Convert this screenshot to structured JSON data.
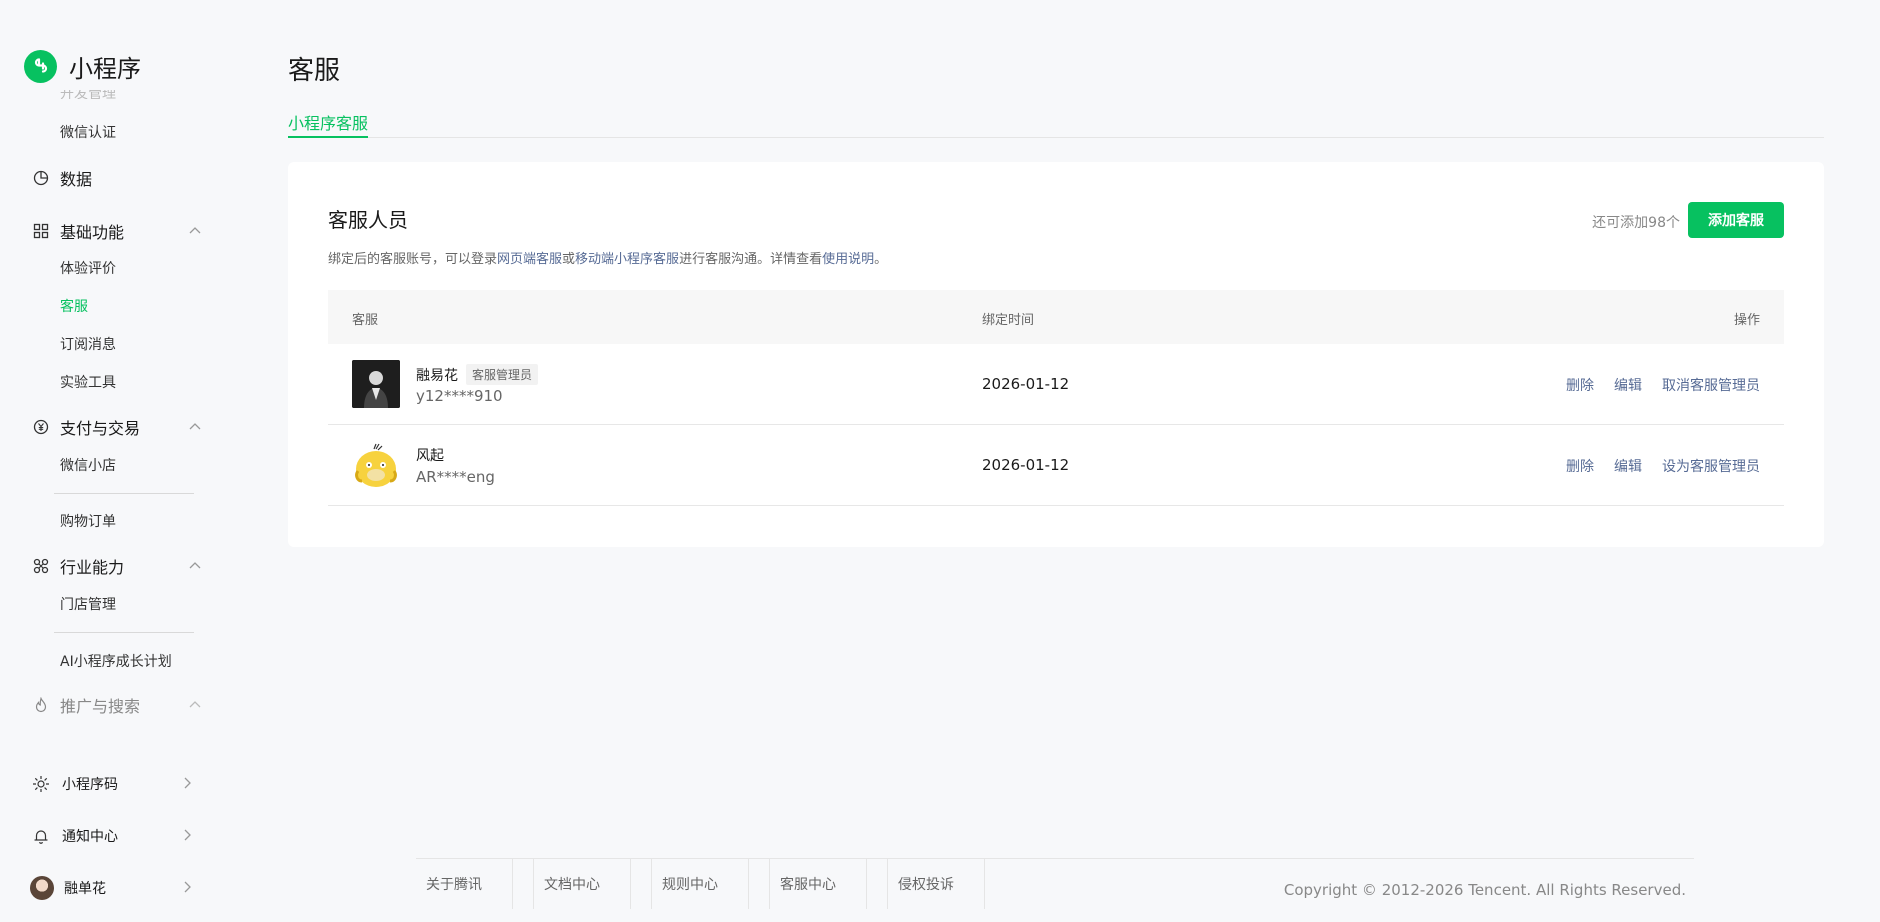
{
  "brand": {
    "name": "小程序"
  },
  "sidebar": {
    "partial_top": "开发管理",
    "items": [
      {
        "type": "sub",
        "label": "微信认证"
      },
      {
        "type": "group",
        "label": "数据",
        "icon": "clock-pie-icon"
      },
      {
        "type": "group",
        "label": "基础功能",
        "icon": "grid-apps-icon",
        "expanded": true
      },
      {
        "type": "sub",
        "label": "体验评价"
      },
      {
        "type": "sub",
        "label": "客服",
        "active": true
      },
      {
        "type": "sub",
        "label": "订阅消息"
      },
      {
        "type": "sub",
        "label": "实验工具"
      },
      {
        "type": "group",
        "label": "支付与交易",
        "icon": "yuan-icon",
        "expanded": true
      },
      {
        "type": "sub",
        "label": "微信小店"
      },
      {
        "type": "sub",
        "label": "购物订单"
      },
      {
        "type": "group",
        "label": "行业能力",
        "icon": "industry-icon",
        "expanded": true
      },
      {
        "type": "sub",
        "label": "门店管理"
      },
      {
        "type": "sub",
        "label": "AI小程序成长计划"
      },
      {
        "type": "group",
        "label": "推广与搜索",
        "icon": "fire-icon",
        "expanded": true
      }
    ],
    "bottom": [
      {
        "label": "小程序码",
        "icon": "qrcode-sun-icon"
      },
      {
        "label": "通知中心",
        "icon": "bell-icon"
      },
      {
        "label": "融单花",
        "icon": "user-avatar"
      }
    ]
  },
  "page": {
    "title": "客服",
    "tab": "小程序客服"
  },
  "card": {
    "title": "客服人员",
    "desc_prefix": "绑定后的客服账号，可以登录",
    "desc_link1": "网页端客服",
    "desc_or": "或",
    "desc_link2": "移动端小程序客服",
    "desc_mid": "进行客服沟通。详情查看",
    "desc_link3": "使用说明",
    "desc_end": "。",
    "quota": "还可添加98个",
    "add_button": "添加客服"
  },
  "table": {
    "headers": {
      "agent": "客服",
      "bind_time": "绑定时间",
      "actions": "操作"
    },
    "rows": [
      {
        "name": "融易花",
        "tag": "客服管理员",
        "account": "y12****910",
        "date": "2026-01-12",
        "actions": [
          "删除",
          "编辑",
          "取消客服管理员"
        ]
      },
      {
        "name": "风起",
        "tag": "",
        "account": "AR****eng",
        "date": "2026-01-12",
        "actions": [
          "删除",
          "编辑",
          "设为客服管理员"
        ]
      }
    ]
  },
  "footer": {
    "links": [
      "关于腾讯",
      "文档中心",
      "规则中心",
      "客服中心",
      "侵权投诉"
    ],
    "copyright": "Copyright © 2012-2026 Tencent. All Rights Reserved."
  },
  "colors": {
    "accent": "#07c160",
    "link": "#576b95"
  }
}
